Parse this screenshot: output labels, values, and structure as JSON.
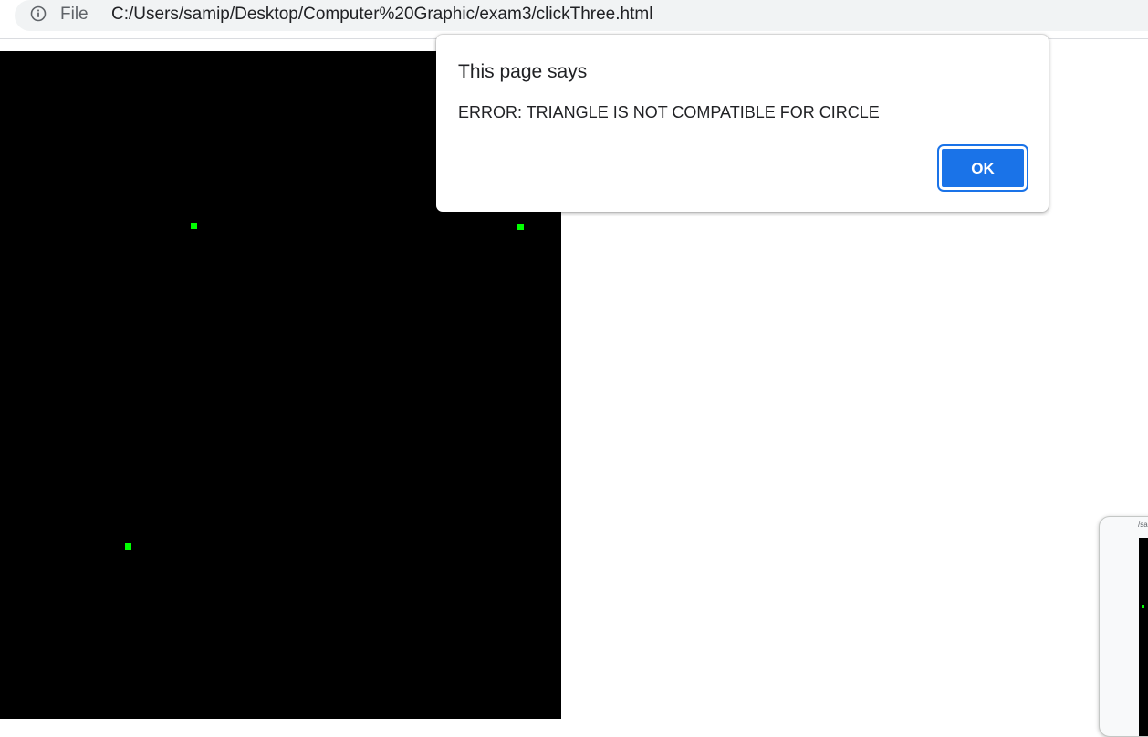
{
  "browser": {
    "protocol_label": "File",
    "url": "C:/Users/samip/Desktop/Computer%20Graphic/exam3/clickThree.html"
  },
  "dialog": {
    "title": "This page says",
    "message": "ERROR: TRIANGLE IS NOT COMPATIBLE FOR CIRCLE",
    "ok_label": "OK"
  },
  "canvas": {
    "background": "#000000",
    "point_color": "#00ff00",
    "clicked_point_count": 3
  },
  "thumbnail": {
    "url_fragment": "/sa"
  },
  "colors": {
    "accent": "#1a73e8",
    "omnibox_bg": "#f1f3f4"
  }
}
